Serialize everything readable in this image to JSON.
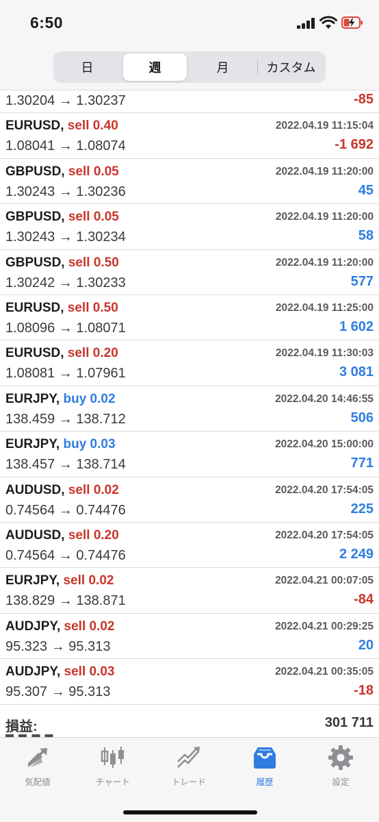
{
  "status_bar": {
    "time": "6:50"
  },
  "period_tabs": [
    {
      "label": "日",
      "active": false
    },
    {
      "label": "週",
      "active": true
    },
    {
      "label": "月",
      "active": false
    },
    {
      "label": "カスタム",
      "active": false
    }
  ],
  "deals": [
    {
      "symbol": "",
      "side": "",
      "volume": "",
      "datetime": "",
      "open_price": "1.30204",
      "close_price": "1.30237",
      "profit": "-85",
      "sign": "neg"
    },
    {
      "symbol": "EURUSD,",
      "side": "sell",
      "volume": "0.40",
      "datetime": "2022.04.19 11:15:04",
      "open_price": "1.08041",
      "close_price": "1.08074",
      "profit": "-1 692",
      "sign": "neg"
    },
    {
      "symbol": "GBPUSD,",
      "side": "sell",
      "volume": "0.05",
      "datetime": "2022.04.19 11:20:00",
      "open_price": "1.30243",
      "close_price": "1.30236",
      "profit": "45",
      "sign": "pos"
    },
    {
      "symbol": "GBPUSD,",
      "side": "sell",
      "volume": "0.05",
      "datetime": "2022.04.19 11:20:00",
      "open_price": "1.30243",
      "close_price": "1.30234",
      "profit": "58",
      "sign": "pos"
    },
    {
      "symbol": "GBPUSD,",
      "side": "sell",
      "volume": "0.50",
      "datetime": "2022.04.19 11:20:00",
      "open_price": "1.30242",
      "close_price": "1.30233",
      "profit": "577",
      "sign": "pos"
    },
    {
      "symbol": "EURUSD,",
      "side": "sell",
      "volume": "0.50",
      "datetime": "2022.04.19 11:25:00",
      "open_price": "1.08096",
      "close_price": "1.08071",
      "profit": "1 602",
      "sign": "pos"
    },
    {
      "symbol": "EURUSD,",
      "side": "sell",
      "volume": "0.20",
      "datetime": "2022.04.19 11:30:03",
      "open_price": "1.08081",
      "close_price": "1.07961",
      "profit": "3 081",
      "sign": "pos"
    },
    {
      "symbol": "EURJPY,",
      "side": "buy",
      "volume": "0.02",
      "datetime": "2022.04.20 14:46:55",
      "open_price": "138.459",
      "close_price": "138.712",
      "profit": "506",
      "sign": "pos"
    },
    {
      "symbol": "EURJPY,",
      "side": "buy",
      "volume": "0.03",
      "datetime": "2022.04.20 15:00:00",
      "open_price": "138.457",
      "close_price": "138.714",
      "profit": "771",
      "sign": "pos"
    },
    {
      "symbol": "AUDUSD,",
      "side": "sell",
      "volume": "0.02",
      "datetime": "2022.04.20 17:54:05",
      "open_price": "0.74564",
      "close_price": "0.74476",
      "profit": "225",
      "sign": "pos"
    },
    {
      "symbol": "AUDUSD,",
      "side": "sell",
      "volume": "0.20",
      "datetime": "2022.04.20 17:54:05",
      "open_price": "0.74564",
      "close_price": "0.74476",
      "profit": "2 249",
      "sign": "pos"
    },
    {
      "symbol": "EURJPY,",
      "side": "sell",
      "volume": "0.02",
      "datetime": "2022.04.21 00:07:05",
      "open_price": "138.829",
      "close_price": "138.871",
      "profit": "-84",
      "sign": "neg"
    },
    {
      "symbol": "AUDJPY,",
      "side": "sell",
      "volume": "0.02",
      "datetime": "2022.04.21 00:29:25",
      "open_price": "95.323",
      "close_price": "95.313",
      "profit": "20",
      "sign": "pos"
    },
    {
      "symbol": "AUDJPY,",
      "side": "sell",
      "volume": "0.03",
      "datetime": "2022.04.21 00:35:05",
      "open_price": "95.307",
      "close_price": "95.313",
      "profit": "-18",
      "sign": "neg"
    }
  ],
  "arrow": "→",
  "summary": {
    "label": "損益:",
    "value": "301 711"
  },
  "colors": {
    "sell": "#c8352b",
    "buy": "#2f7de1",
    "negative": "#c8352b",
    "positive": "#2f7de1",
    "active_tab": "#2f7de1"
  },
  "tab_bar": [
    {
      "label": "気配値",
      "icon": "quotes-icon",
      "active": false
    },
    {
      "label": "チャート",
      "icon": "chart-icon",
      "active": false
    },
    {
      "label": "トレード",
      "icon": "trade-icon",
      "active": false
    },
    {
      "label": "履歴",
      "icon": "history-icon",
      "active": true
    },
    {
      "label": "設定",
      "icon": "settings-icon",
      "active": false
    }
  ]
}
